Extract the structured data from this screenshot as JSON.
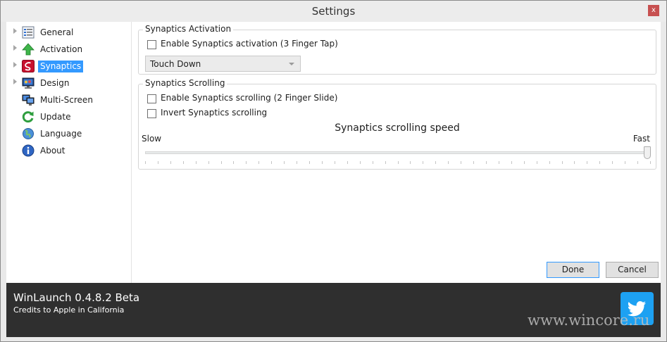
{
  "window": {
    "title": "Settings",
    "close_glyph": "x"
  },
  "sidebar": {
    "items": [
      {
        "label": "General",
        "icon": "checklist-icon"
      },
      {
        "label": "Activation",
        "icon": "green-up-arrow-icon"
      },
      {
        "label": "Synaptics",
        "icon": "synaptics-logo-icon",
        "selected": true
      },
      {
        "label": "Design",
        "icon": "monitor-design-icon"
      },
      {
        "label": "Multi-Screen",
        "icon": "multi-monitor-icon"
      },
      {
        "label": "Update",
        "icon": "refresh-icon"
      },
      {
        "label": "Language",
        "icon": "globe-icon"
      },
      {
        "label": "About",
        "icon": "info-icon"
      }
    ]
  },
  "activation_group": {
    "title": "Synaptics Activation",
    "enable_label": "Enable Synaptics activation (3 Finger Tap)",
    "enable_checked": false,
    "combo_value": "Touch Down"
  },
  "scrolling_group": {
    "title": "Synaptics Scrolling",
    "enable_label": "Enable Synaptics scrolling (2 Finger Slide)",
    "enable_checked": false,
    "invert_label": "Invert Synaptics scrolling",
    "invert_checked": false,
    "speed_title": "Synaptics scrolling speed",
    "slow_label": "Slow",
    "fast_label": "Fast",
    "speed_level": 1.0,
    "tick_count": 40
  },
  "buttons": {
    "done_label": "Done",
    "cancel_label": "Cancel"
  },
  "footer": {
    "app_name": "WinLaunch 0.4.8.2 Beta",
    "credits": "Credits to Apple in California",
    "twitter_icon": "twitter-bird-icon",
    "watermark": "www.wincore.ru"
  },
  "colors": {
    "selection": "#3399ff",
    "footer_bg": "#2f2f2f",
    "twitter": "#1da1f2"
  }
}
